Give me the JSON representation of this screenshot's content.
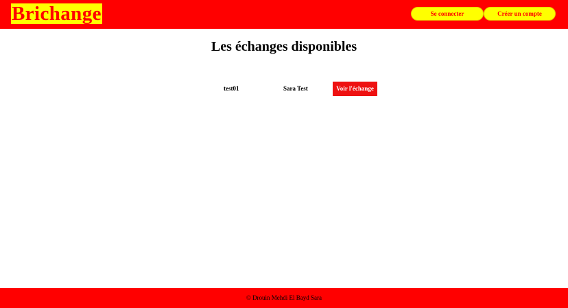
{
  "colors": {
    "brand_red": "#ff0000",
    "brand_yellow": "#ffff00",
    "button_red": "#ee1111",
    "text": "#000000",
    "background": "#ffffff"
  },
  "header": {
    "logo": "Brichange",
    "login_label": "Se connecter",
    "signup_label": "Créer un compte"
  },
  "main": {
    "title": "Les échanges disponibles",
    "exchanges": [
      {
        "user": "test01",
        "partner": "Sara Test",
        "view_label": "Voir l'échange"
      }
    ]
  },
  "footer": {
    "text": "© Drouin Mehdi El Bayd Sara"
  }
}
